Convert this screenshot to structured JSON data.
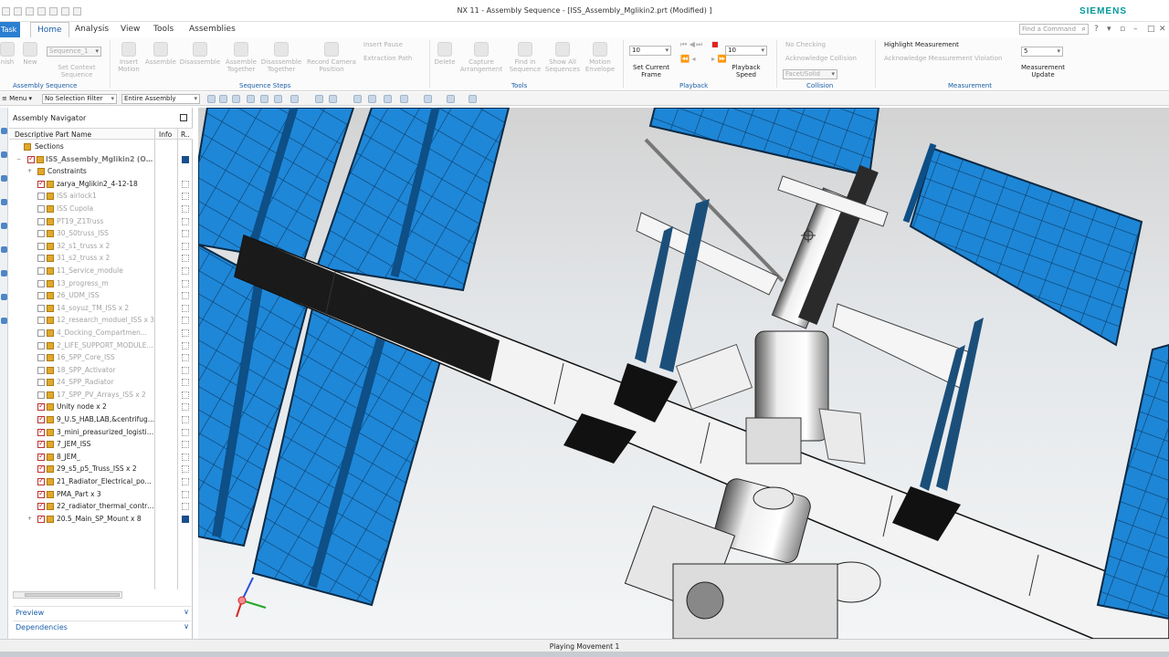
{
  "window": {
    "title": "NX 11 - Assembly Sequence - [ISS_Assembly_Mglikin2.prt (Modified) ]",
    "brand": "SIEMENS"
  },
  "file_tab": "Task",
  "tabs": [
    "Home",
    "Analysis",
    "View",
    "Tools",
    "Assemblies"
  ],
  "active_tab": "Home",
  "find_command": {
    "placeholder": "Find a Command"
  },
  "ribbon": {
    "finish": "nish",
    "new": "New",
    "sequence_select": "Sequence_1",
    "set_context": "Set Context Sequence",
    "insert_motion": "Insert Motion",
    "assemble": "Assemble",
    "disassemble": "Disassemble",
    "assemble_together": "Assemble Together",
    "disassemble_together": "Disassemble Together",
    "record_camera": "Record Camera Position",
    "insert_pause": "Insert Pause",
    "extraction_path": "Extraction Path",
    "delete": "Delete",
    "capture_arrangement": "Capture Arrangement",
    "find_in_sequence": "Find in Sequence",
    "show_all_sequences": "Show All Sequences",
    "motion_envelope": "Motion Envelope",
    "frame_value": "10",
    "set_current_frame": "Set Current Frame",
    "speed_value": "10",
    "playback_speed": "Playback Speed",
    "no_checking": "No Checking",
    "acknowledge_collision": "Acknowledge Collision",
    "facet_solid": "Facet/Solid",
    "highlight_measurement": "Highlight Measurement",
    "acknowledge_violation": "Acknowledge Measurement Violation",
    "measurement_value": "5",
    "measurement_update": "Measurement Update"
  },
  "groups": {
    "assembly_sequence": "Assembly Sequence",
    "sequence_steps": "Sequence Steps",
    "tools": "Tools",
    "playback": "Playback",
    "collision": "Collision",
    "measurement": "Measurement"
  },
  "toolbar2": {
    "menu": "Menu",
    "selection_filter": "No Selection Filter",
    "scope": "Entire Assembly"
  },
  "navigator": {
    "title": "Assembly Navigator",
    "columns": {
      "name": "Descriptive Part Name",
      "info": "Info",
      "r": "R.."
    },
    "items": [
      {
        "label": "Sections",
        "level": 1,
        "kind": "folder"
      },
      {
        "label": "ISS_Assembly_Mglikin2 (Orde...",
        "level": 1,
        "kind": "root"
      },
      {
        "label": "Constraints",
        "level": 2,
        "kind": "constraints"
      },
      {
        "label": "zarya_Mglikin2_4-12-18",
        "level": 2,
        "on": true
      },
      {
        "label": "ISS airlock1",
        "level": 2,
        "on": false
      },
      {
        "label": "ISS Cupola",
        "level": 2,
        "on": false
      },
      {
        "label": "PT19_Z1Truss",
        "level": 2,
        "on": false
      },
      {
        "label": "30_S0truss_ISS",
        "level": 2,
        "on": false
      },
      {
        "label": "32_s1_truss x 2",
        "level": 2,
        "on": false
      },
      {
        "label": "31_s2_truss x 2",
        "level": 2,
        "on": false
      },
      {
        "label": "11_Service_module",
        "level": 2,
        "on": false
      },
      {
        "label": "13_progress_m",
        "level": 2,
        "on": false
      },
      {
        "label": "26_UDM_ISS",
        "level": 2,
        "on": false
      },
      {
        "label": "14_soyuz_TM_ISS x 2",
        "level": 2,
        "on": false
      },
      {
        "label": "12_research_moduel_ISS x 3",
        "level": 2,
        "on": false
      },
      {
        "label": "4_Docking_Compartmen...",
        "level": 2,
        "on": false
      },
      {
        "label": "2_LIFE_SUPPORT_MODULE...",
        "level": 2,
        "on": false
      },
      {
        "label": "16_SPP_Core_ISS",
        "level": 2,
        "on": false
      },
      {
        "label": "18_SPP_Activator",
        "level": 2,
        "on": false
      },
      {
        "label": "24_SPP_Radiator",
        "level": 2,
        "on": false
      },
      {
        "label": "17_SPP_PV_Arrays_ISS x 2",
        "level": 2,
        "on": false
      },
      {
        "label": "Unity node x 2",
        "level": 2,
        "on": true
      },
      {
        "label": "9_U.S_HAB,LAB,&centrifug...",
        "level": 2,
        "on": true
      },
      {
        "label": "3_mini_preasurized_logistic...",
        "level": 2,
        "on": true
      },
      {
        "label": "7_JEM_ISS",
        "level": 2,
        "on": true
      },
      {
        "label": "8_JEM_",
        "level": 2,
        "on": true
      },
      {
        "label": "29_s5_p5_Truss_ISS x 2",
        "level": 2,
        "on": true
      },
      {
        "label": "21_Radiator_Electrical_pow...",
        "level": 2,
        "on": true
      },
      {
        "label": "PMA_Part x 3",
        "level": 2,
        "on": true
      },
      {
        "label": "22_radiator_thermal_contro...",
        "level": 2,
        "on": true
      },
      {
        "label": "20.5_Main_SP_Mount x 8",
        "level": 2,
        "on": true
      }
    ],
    "panels": [
      "Preview",
      "Dependencies"
    ]
  },
  "status": "Playing Movement 1",
  "colors": {
    "accent": "#1a5fa8",
    "panel_blue": "#1e88d6",
    "siemens": "#009999"
  }
}
